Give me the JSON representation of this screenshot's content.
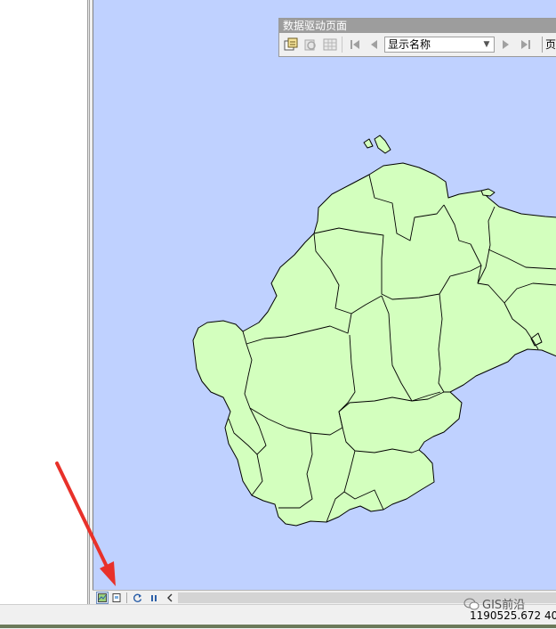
{
  "toolbar": {
    "title": "数据驱动页面",
    "name_field": {
      "value": "显示名称",
      "placeholder": "显示名称"
    },
    "page_label": "页"
  },
  "status": {
    "coordinates": "1190525.672  40"
  },
  "watermark": {
    "text": "GIS前沿"
  },
  "colors": {
    "water": "#bfd1ff",
    "land": "#d3ffbe",
    "annotation_arrow": "#e8312a"
  },
  "icons": {
    "first_page": "first-page-icon",
    "previous_page": "previous-page-icon",
    "next_page": "next-page-icon",
    "last_page": "last-page-icon"
  }
}
